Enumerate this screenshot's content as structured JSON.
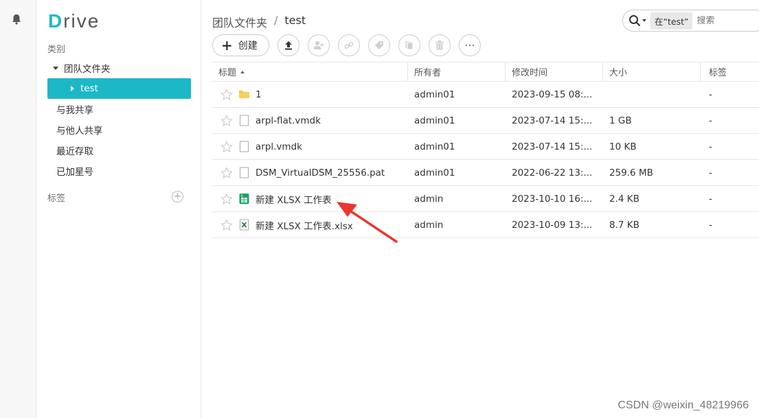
{
  "app": {
    "logo_first": "D",
    "logo_rest": "rive"
  },
  "sidebar": {
    "category_label": "类别",
    "team_folder": "团队文件夹",
    "active_folder": "test",
    "items": [
      "与我共享",
      "与他人共享",
      "最近存取",
      "已加星号"
    ],
    "tags_label": "标签",
    "add_tag": "+"
  },
  "breadcrumb": {
    "root": "团队文件夹",
    "sep": "/",
    "current": "test"
  },
  "search": {
    "scope": "在“test”",
    "placeholder": "搜索"
  },
  "toolbar": {
    "create_label": "创建"
  },
  "table": {
    "headers": {
      "title": "标题",
      "owner": "所有者",
      "modified": "修改时间",
      "size": "大小",
      "tags": "标签"
    },
    "rows": [
      {
        "type": "folder",
        "name": "1",
        "owner": "admin01",
        "modified": "2023-09-15 08:...",
        "size": "",
        "tag": "-"
      },
      {
        "type": "file",
        "name": "arpl-flat.vmdk",
        "owner": "admin01",
        "modified": "2023-07-14 15:...",
        "size": "1 GB",
        "tag": "-"
      },
      {
        "type": "file",
        "name": "arpl.vmdk",
        "owner": "admin01",
        "modified": "2023-07-14 15:...",
        "size": "10 KB",
        "tag": "-"
      },
      {
        "type": "file",
        "name": "DSM_VirtualDSM_25556.pat",
        "owner": "admin01",
        "modified": "2022-06-22 13:...",
        "size": "259.6 MB",
        "tag": "-"
      },
      {
        "type": "sheet",
        "name": "新建 XLSX 工作表",
        "owner": "admin",
        "modified": "2023-10-10 16:...",
        "size": "2.4 KB",
        "tag": "-"
      },
      {
        "type": "xlsx",
        "name": "新建 XLSX 工作表.xlsx",
        "owner": "admin",
        "modified": "2023-10-09 13:...",
        "size": "8.7 KB",
        "tag": "-"
      }
    ]
  },
  "colors": {
    "accent": "#1cb8c7",
    "annotation_arrow": "#e8382f",
    "folder": "#f5c242",
    "sheet_green": "#1aa260"
  },
  "watermark": "CSDN @weixin_48219966"
}
